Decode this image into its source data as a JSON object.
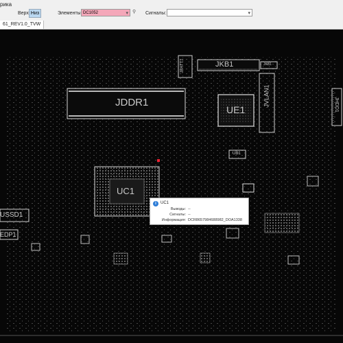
{
  "toolbar": {
    "title": "рика",
    "side_label": "Верх",
    "side_button": "Низ",
    "elements_label": "Элементы:",
    "elements_value": "DC1052",
    "signals_label": "Сигналы:",
    "signals_value": ""
  },
  "tab": {
    "label": "61_REV1.0_TVW"
  },
  "board": {
    "labels": [
      "JDDR1",
      "UC1",
      "UE1",
      "JKB1",
      "JVLAN1",
      "USSD1",
      "EDP1",
      "UB1",
      "JBATT1",
      "JHDD1",
      "JKB1"
    ]
  },
  "tooltip": {
    "title": "UC1",
    "rows": [
      {
        "label": "Выводы:",
        "value": "--"
      },
      {
        "label": "Сигналы:",
        "value": "--"
      },
      {
        "label": "Информация:",
        "value": "DCR8657984688982_DOA1338"
      }
    ]
  },
  "colors": {
    "toolbar_bg": "#f0f0f0",
    "board_bg": "#070707",
    "elements_field_bg": "#f4a7b9",
    "side_button_bg": "#b9d7f0"
  }
}
